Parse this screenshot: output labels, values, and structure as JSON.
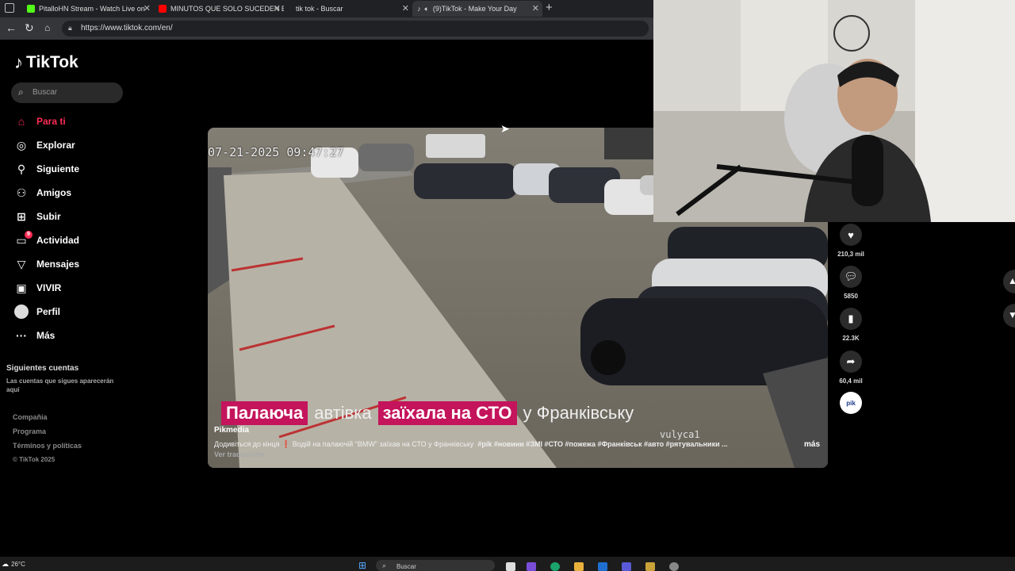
{
  "browser": {
    "tabs": [
      {
        "title": "PitalloHN Stream - Watch Live on",
        "favicon_color": "#53fc18"
      },
      {
        "title": "MINUTOS QUE SOLO SUCEDEN E",
        "favicon_color": "#ff0000"
      },
      {
        "title": "tik tok - Buscar",
        "favicon_color": "#2b6cd6"
      },
      {
        "title": "(9)TikTok - Make Your Day",
        "favicon_color": "#25f4ee"
      }
    ],
    "url": "https://www.tiktok.com/en/"
  },
  "sidebar": {
    "logo": "TikTok",
    "search_placeholder": "Buscar",
    "items": [
      {
        "label": "Para ti",
        "icon": "home-icon"
      },
      {
        "label": "Explorar",
        "icon": "compass-icon"
      },
      {
        "label": "Siguiente",
        "icon": "following-icon"
      },
      {
        "label": "Amigos",
        "icon": "friends-icon"
      },
      {
        "label": "Subir",
        "icon": "upload-icon"
      },
      {
        "label": "Actividad",
        "icon": "activity-icon",
        "badge": "9"
      },
      {
        "label": "Mensajes",
        "icon": "messages-icon"
      },
      {
        "label": "VIVIR",
        "icon": "live-icon"
      },
      {
        "label": "Perfil",
        "icon": "profile-avatar"
      },
      {
        "label": "Más",
        "icon": "more-icon"
      }
    ],
    "following_heading": "Siguientes cuentas",
    "following_text": "Las cuentas que sigues aparecerán aquí",
    "footer": [
      "Compañía",
      "Programa",
      "Términos y políticas",
      "© TikTok 2025"
    ]
  },
  "video": {
    "timestamp": "07-21-2025 09:47:27",
    "caption_parts": [
      "Палаюча",
      "автівка",
      "заїхала на СТО",
      "у Франківську"
    ],
    "watermark": "vulyca1",
    "author": "Pikmedia",
    "desc_prefix": "Додивіться до кінця",
    "desc_text": "Водій на палаючій \"BMW\" заїхав на СТО у Франківську",
    "hashtags": "#pik #новини #ЗМІ #СТО #пожежа #Франківськ #авто #рятувальники ...",
    "more_label": "más",
    "translate_label": "Ver traducción"
  },
  "actions": {
    "likes": "210,3 mil",
    "comments": "5850",
    "saves": "22.3K",
    "shares": "60,4 mil",
    "brand_avatar": "pik"
  },
  "taskbar": {
    "temperature": "26°C",
    "search": "Buscar"
  }
}
